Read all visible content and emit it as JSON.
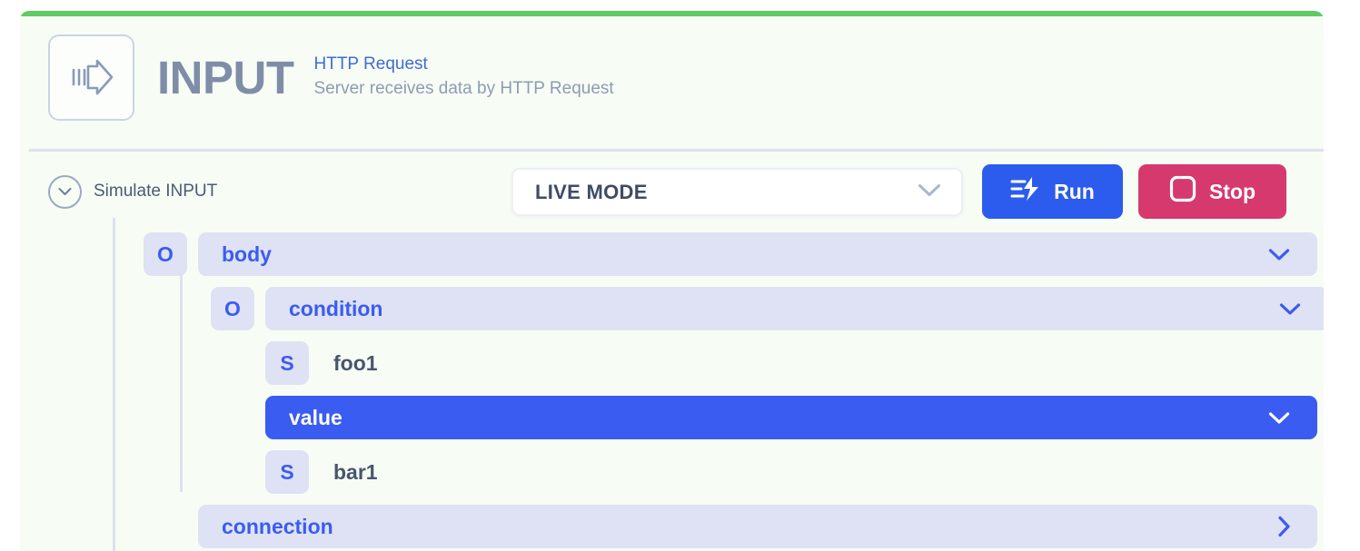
{
  "panel": {
    "accent_color": "#5ecb63",
    "background_color": "#f7fdf4"
  },
  "header": {
    "icon": "input-arrow-icon",
    "title": "INPUT",
    "link_label": "HTTP Request",
    "subtitle": "Server receives data by HTTP Request",
    "link_color": "#3f6bd8",
    "title_color": "#7f8da8"
  },
  "toolbar": {
    "simulate_label": "Simulate INPUT",
    "simulate_icon": "chevron-down-circle-icon",
    "mode_select": {
      "value": "LIVE MODE",
      "chevron_icon": "chevron-down-icon"
    },
    "run_button": {
      "label": "Run",
      "icon": "run-lightning-icon",
      "color": "#2c5ced"
    },
    "stop_button": {
      "label": "Stop",
      "icon": "stop-square-icon",
      "color": "#d6396e"
    }
  },
  "tree": {
    "selected_color": "#3b5cf0",
    "row_color": "#dee2f4",
    "rows": [
      {
        "key": "body",
        "type_badge": "O",
        "chevron": "chevron-down-icon",
        "selected": false,
        "depth": 1
      },
      {
        "key": "condition",
        "type_badge": "O",
        "chevron": "chevron-down-icon",
        "selected": false,
        "depth": 2
      },
      {
        "key": "foo1",
        "type_badge": "S",
        "chevron": null,
        "selected": false,
        "depth": 3
      },
      {
        "key": "value",
        "type_badge": null,
        "chevron": "chevron-down-icon",
        "selected": true,
        "depth": 3
      },
      {
        "key": "bar1",
        "type_badge": "S",
        "chevron": null,
        "selected": false,
        "depth": 3
      },
      {
        "key": "connection",
        "type_badge": null,
        "chevron": "chevron-right-icon",
        "selected": false,
        "depth": 2
      }
    ]
  }
}
